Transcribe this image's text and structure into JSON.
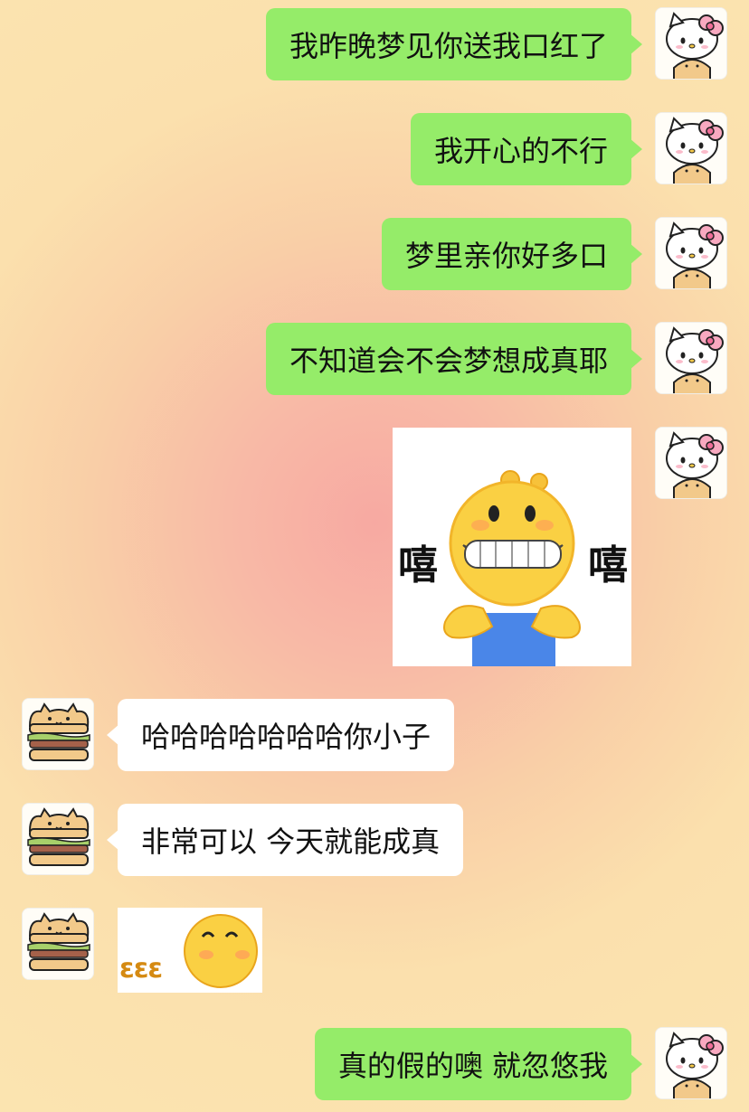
{
  "colors": {
    "outgoing_bubble": "#95ec69",
    "incoming_bubble": "#ffffff"
  },
  "avatars": {
    "me": "hello-kitty-avatar",
    "them": "bread-cat-avatar"
  },
  "messages": [
    {
      "side": "right",
      "type": "text",
      "text": "我昨晚梦见你送我口红了"
    },
    {
      "side": "right",
      "type": "text",
      "text": "我开心的不行"
    },
    {
      "side": "right",
      "type": "text",
      "text": "梦里亲你好多口"
    },
    {
      "side": "right",
      "type": "text",
      "text": "不知道会不会梦想成真耶"
    },
    {
      "side": "right",
      "type": "sticker",
      "name": "grinning-emoji-sticker",
      "left_text": "嘻",
      "right_text": "嘻"
    },
    {
      "side": "left",
      "type": "text",
      "text": "哈哈哈哈哈哈哈你小子"
    },
    {
      "side": "left",
      "type": "text",
      "text": "非常可以 今天就能成真"
    },
    {
      "side": "left",
      "type": "sticker",
      "name": "blowing-kiss-emoji-sticker",
      "caption": "εεε"
    },
    {
      "side": "right",
      "type": "text",
      "text": "真的假的噢 就忽悠我"
    }
  ]
}
